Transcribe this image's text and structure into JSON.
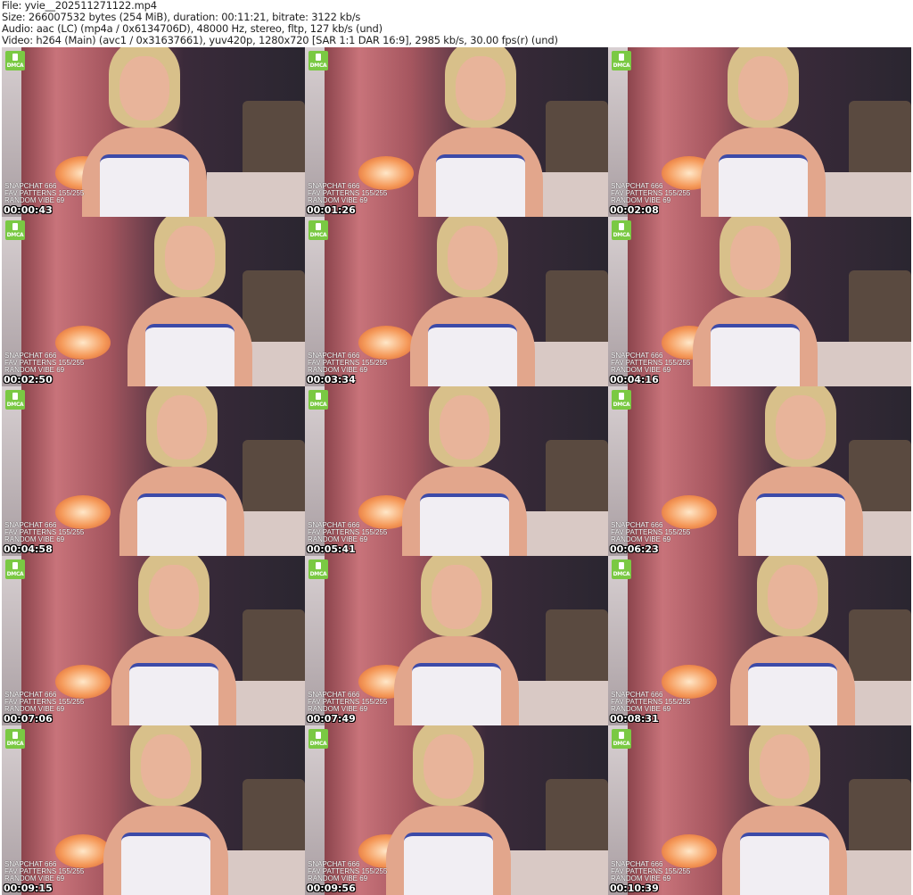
{
  "header": {
    "file": "File: yvie__202511271122.mp4",
    "size": "Size: 266007532 bytes (254 MiB), duration: 00:11:21, bitrate: 3122 kb/s",
    "audio": "Audio: aac (LC) (mp4a / 0x6134706D), 48000 Hz, stereo, fltp, 127 kb/s (und)",
    "video": "Video: h264 (Main) (avc1 / 0x31637661), yuv420p, 1280x720 [SAR 1:1 DAR 16:9], 2985 kb/s, 30.00 fps(r) (und)"
  },
  "overlay": {
    "badge": "DMCA",
    "line1": "SNAPCHAT 666",
    "line2": "FAV PATTERNS 155/255",
    "line3": "RANDOM VIBE 69"
  },
  "frames": [
    {
      "timestamp": "00:00:43"
    },
    {
      "timestamp": "00:01:26"
    },
    {
      "timestamp": "00:02:08"
    },
    {
      "timestamp": "00:02:50"
    },
    {
      "timestamp": "00:03:34"
    },
    {
      "timestamp": "00:04:16"
    },
    {
      "timestamp": "00:04:58"
    },
    {
      "timestamp": "00:05:41"
    },
    {
      "timestamp": "00:06:23"
    },
    {
      "timestamp": "00:07:06"
    },
    {
      "timestamp": "00:07:49"
    },
    {
      "timestamp": "00:08:31"
    },
    {
      "timestamp": "00:09:15"
    },
    {
      "timestamp": "00:09:56"
    },
    {
      "timestamp": "00:10:39"
    }
  ]
}
